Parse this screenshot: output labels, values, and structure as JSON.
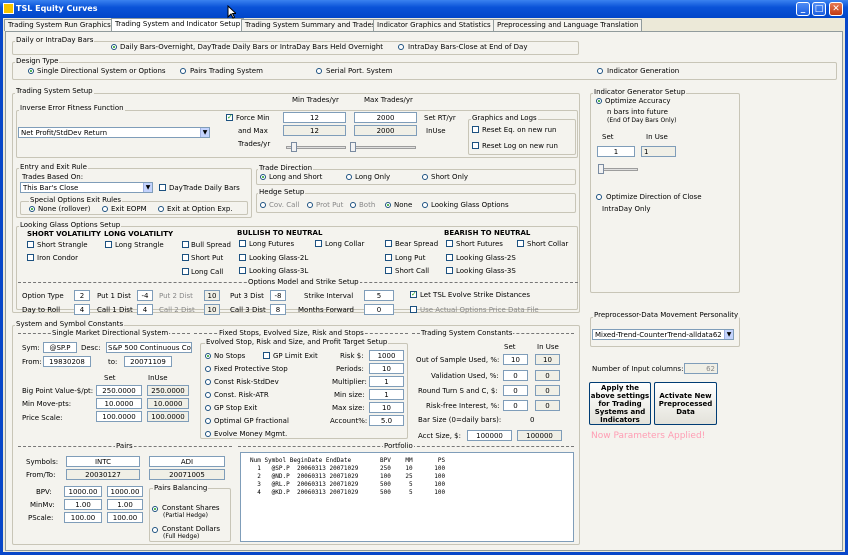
{
  "window": {
    "title": "TSL Equity Curves",
    "min": "_",
    "max": "□",
    "close": "✕"
  },
  "tabs": [
    "Trading System Run Graphics",
    "Trading System and Indicator Setup",
    "Trading System Summary and Trades",
    "Indicator Graphics and Statistics",
    "Preprocessing and Language Translation"
  ],
  "bars": {
    "title": "Daily or IntraDay Bars",
    "opt1": "Daily Bars-Overnight, DayTrade Daily Bars or IntraDay Bars Held Overnight",
    "opt2": "IntraDay Bars-Close at End of Day"
  },
  "design": {
    "title": "Design Type",
    "opt1": "Single Directional System or Options",
    "opt2": "Pairs Trading System",
    "opt3": "Serial Port. System",
    "opt4": "Indicator Generation"
  },
  "tss": {
    "title": "Trading System Setup",
    "ief_title": "Inverse Error Fitness Function",
    "ief_value": "Net Profit/StdDev Return",
    "force_min": "Force Min",
    "and_max": "and Max",
    "trades_yr": "Trades/yr",
    "min_hdr": "Min Trades/yr",
    "max_hdr": "Max Trades/yr",
    "min1": "12",
    "max1": "2000",
    "min2": "12",
    "max2": "2000",
    "set_rt": "Set RT/yr",
    "inuse": "InUse",
    "gl_title": "Graphics and Logs",
    "reset_eq": "Reset Eq. on new run",
    "reset_log": "Reset Log on new run"
  },
  "entry": {
    "title": "Entry and Exit Rule",
    "based_on": "Trades Based On:",
    "rule_value": "This Bar's Close",
    "daytrade": "DayTrade Daily Bars",
    "special": "Special Options Exit Rules",
    "none": "None (rollover)",
    "eopm": "Exit EOPM",
    "optexp": "Exit at Option Exp."
  },
  "direction": {
    "title": "Trade Direction",
    "ls": "Long and Short",
    "lo": "Long Only",
    "so": "Short Only"
  },
  "hedge": {
    "title": "Hedge Setup",
    "cov": "Cov. Call",
    "prot": "Prot Put",
    "both": "Both",
    "none": "None",
    "lg": "Looking Glass Options"
  },
  "glass": {
    "title": "Looking Glass Options Setup",
    "short_vol": "SHORT VOLATILITY",
    "long_vol": "LONG VOLATILITY",
    "bull": "BULLISH TO NEUTRAL",
    "bear": "BEARISH TO NEUTRAL",
    "short_strangle": "Short Strangle",
    "long_strangle": "Long Strangle",
    "iron_condor": "Iron Condor",
    "bull_spread": "Bull Spread",
    "short_put": "Short Put",
    "long_call": "Long Call",
    "long_futures": "Long Futures",
    "long_collar": "Long Collar",
    "lg2l": "Looking Glass-2L",
    "lg3l": "Looking Glass-3L",
    "bear_spread": "Bear Spread",
    "long_put": "Long Put",
    "short_call": "Short Call",
    "short_futures": "Short Futures",
    "short_collar": "Short Collar",
    "lg2s": "Looking Glass-2S",
    "lg3s": "Looking Glass-3S"
  },
  "options": {
    "title": "Options Model and Strike Setup",
    "option_type": "Option Type",
    "option_type_v": "2",
    "day_roll": "Day to Roll",
    "day_roll_v": "4",
    "put1": "Put 1 Dist",
    "put1_v": "-4",
    "call1": "Call 1 Dist",
    "call1_v": "4",
    "put2": "Put 2 Dist",
    "put2_v": "10",
    "call2": "Call 2 Dist",
    "call2_v": "10",
    "put3": "Put 3 Dist",
    "put3_v": "-8",
    "call3": "Call 3 Dist",
    "call3_v": "8",
    "strike": "Strike Interval",
    "strike_v": "5",
    "months": "Months Forward",
    "months_v": "0",
    "evolve": "Let TSL Evolve Strike Distances",
    "actual": "Use Actual Options Price Data File"
  },
  "symbol": {
    "title": "System and Symbol Constants",
    "single_title": "Single Market Directional System",
    "sym": "Sym:",
    "sym_v": "@SP.P",
    "desc": "Desc:",
    "desc_v": "S&P 500 Continuous Co",
    "from": "From:",
    "from_v": "19830208",
    "to": "to:",
    "to_v": "20071109",
    "set": "Set",
    "inuse": "InUse",
    "bpv": "Big Point Value-$/pt:",
    "bpv_set": "250.0000",
    "bpv_use": "250.0000",
    "mm": "Min Move-pts:",
    "mm_set": "10.0000",
    "mm_use": "10.0000",
    "ps": "Price Scale:",
    "ps_set": "100.0000",
    "ps_use": "100.0000"
  },
  "stops": {
    "title": "Fixed Stops, Evolved Size, Risk and Stops",
    "inner": "Evolved Stop, Risk and Size, and Profit Target Setup",
    "nostops": "No Stops",
    "gplimit": "GP Limit Exit",
    "fixed": "Fixed Protective Stop",
    "constrisk": "Const Risk-StdDev",
    "constatr": "Const. Risk-ATR",
    "gpstop": "GP Stop Exit",
    "optimal": "Optimal GP fractional",
    "evolvemm": "Evolve Money Mgmt.",
    "risk": "Risk $:",
    "risk_v": "1000",
    "periods": "Periods:",
    "periods_v": "10",
    "mult": "Multiplier:",
    "mult_v": "1",
    "minsize": "Min size:",
    "minsize_v": "1",
    "maxsize": "Max size:",
    "maxsize_v": "10",
    "account": "Account%:",
    "account_v": "5.0"
  },
  "tsc": {
    "title": "Trading System Constants",
    "set": "Set",
    "inuse": "In Use",
    "oos": "Out of Sample Used, %:",
    "oos_s": "10",
    "oos_u": "10",
    "val": "Validation Used, %:",
    "val_s": "0",
    "val_u": "0",
    "rt": "Round Turn S and C, $:",
    "rt_s": "0",
    "rt_u": "0",
    "rf": "Risk-free Interest, %:",
    "rf_s": "0",
    "rf_u": "0",
    "bs": "Bar Size (0=daily bars):",
    "bs_v": "0",
    "acct": "Acct Size, $:",
    "acct_s": "100000",
    "acct_u": "100000"
  },
  "pairs": {
    "title": "Pairs",
    "symbols": "Symbols:",
    "s1": "INTC",
    "s2": "ADI",
    "fromto": "From/To:",
    "d1": "20030127",
    "d2": "20071005",
    "bpv": "BPV:",
    "bpv1": "1000.00",
    "bpv2": "1000.00",
    "minmv": "MinMv:",
    "mm1": "1.00",
    "mm2": "1.00",
    "pscale": "PScale:",
    "ps1": "100.00",
    "ps2": "100.00",
    "bal": "Pairs Balancing",
    "cs": "Constant Shares",
    "cs_sub": "(Partial Hedge)",
    "cd": "Constant Dollars",
    "cd_sub": "(Full Hedge)"
  },
  "portfolio": {
    "title": "Portfolio",
    "header": "Num Symbol BeginDate EndDate        BPV    MM       PS",
    "rows": [
      "  1   @SP.P  20060313 20071029      250    10      100",
      "  2   @ND.P  20060313 20071029      100    25      100",
      "  3   @RL.P  20060313 20071029      500     5      100",
      "  4   @KD.P  20060313 20071029      500     5      100"
    ]
  },
  "indgen": {
    "title": "Indicator Generator Setup",
    "opt_acc": "Optimize Accuracy",
    "nbars": "n bars into future",
    "nbars_sub": "(End Of Day Bars Only)",
    "set": "Set",
    "inuse": "In Use",
    "set_v": "1",
    "inuse_v": "1",
    "opt_dir": "Optimize Direction of Close",
    "intraday": "IntraDay Only"
  },
  "prep": {
    "title": "Preprocessor-Data Movement Personality",
    "value": "Mixed-Trend-CounterTrend-alldata62",
    "ninput": "Number of Input columns:",
    "ninput_v": "62",
    "apply": "Apply the above settings for Trading Systems and Indicators",
    "activate": "Activate New Preprocessed Data",
    "applied": "Now Parameters Applied!"
  }
}
